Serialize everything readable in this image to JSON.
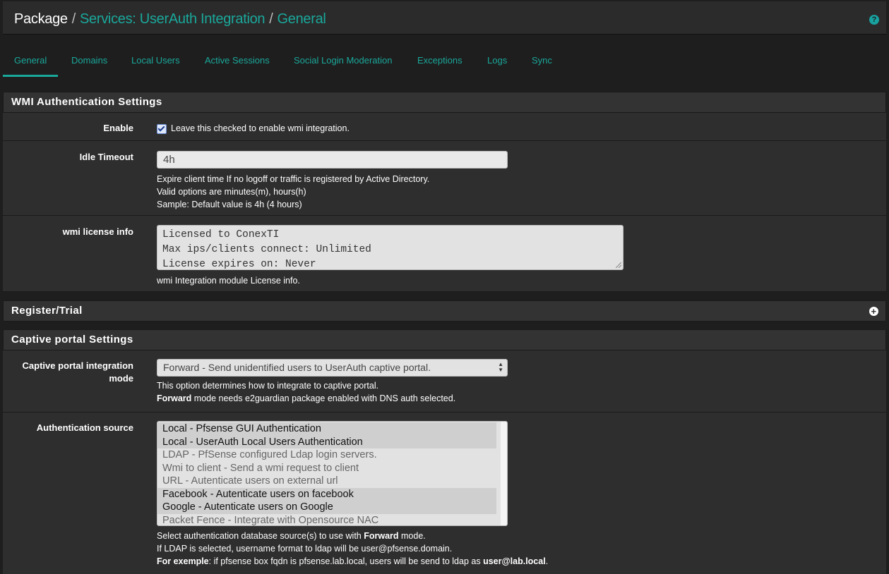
{
  "header": {
    "crumbs": [
      "Package",
      "Services: UserAuth Integration",
      "General"
    ],
    "help_icon": "question-circle-icon"
  },
  "tabs": [
    "General",
    "Domains",
    "Local Users",
    "Active Sessions",
    "Social Login Moderation",
    "Exceptions",
    "Logs",
    "Sync"
  ],
  "active_tab": "General",
  "wmi_section": {
    "title": "WMI Authentication Settings",
    "enable": {
      "label": "Enable",
      "checked": true,
      "text": "Leave this checked to enable wmi integration."
    },
    "idle_timeout": {
      "label": "Idle Timeout",
      "value": "4h",
      "help": [
        "Expire client time If no logoff or traffic is registered by Active Directory.",
        "Valid options are minutes(m), hours(h)",
        "Sample: Default value is 4h (4 hours)"
      ]
    },
    "license": {
      "label": "wmi license info",
      "lines": [
        "Licensed to ConexTI",
        "Max ips/clients connect: Unlimited",
        "License expires on: Never"
      ],
      "help": "wmi Integration module License info."
    }
  },
  "register_section": {
    "title": "Register/Trial",
    "icon": "plus-circle-icon"
  },
  "captive_section": {
    "title": "Captive portal Settings",
    "mode": {
      "label_line1": "Captive portal integration",
      "label_line2": "mode",
      "value": "Forward - Send unidentified users to UserAuth captive portal.",
      "help1": "This option determines how to integrate to captive portal.",
      "help2_bold": "Forward",
      "help2_rest": " mode needs e2guardian package enabled with DNS auth selected."
    },
    "auth_source": {
      "label": "Authentication source",
      "options": [
        {
          "text": "Local - Pfsense GUI Authentication",
          "selected": true
        },
        {
          "text": "Local - UserAuth Local Users Authentication",
          "selected": true
        },
        {
          "text": "LDAP - PfSense configured Ldap login servers.",
          "selected": false
        },
        {
          "text": "Wmi to client - Send a wmi request to client",
          "selected": false
        },
        {
          "text": "URL - Autenticate users on external url",
          "selected": false
        },
        {
          "text": "Facebook - Autenticate users on facebook",
          "selected": true
        },
        {
          "text": "Google - Autenticate users on Google",
          "selected": true
        },
        {
          "text": "Packet Fence - Integrate with Opensource NAC",
          "selected": false
        }
      ],
      "help1_pre": "Select authentication database source(s) to use with ",
      "help1_bold": "Forward",
      "help1_post": " mode.",
      "help2": "If LDAP is selected, username format to ldap will be user@pfsense.domain.",
      "help3_bold": "For exemple",
      "help3_mid": ": if pfsense box fqdn is pfsense.lab.local, users will be send to ldap as ",
      "help3_bold2": "user@lab.local",
      "help3_end": "."
    }
  }
}
